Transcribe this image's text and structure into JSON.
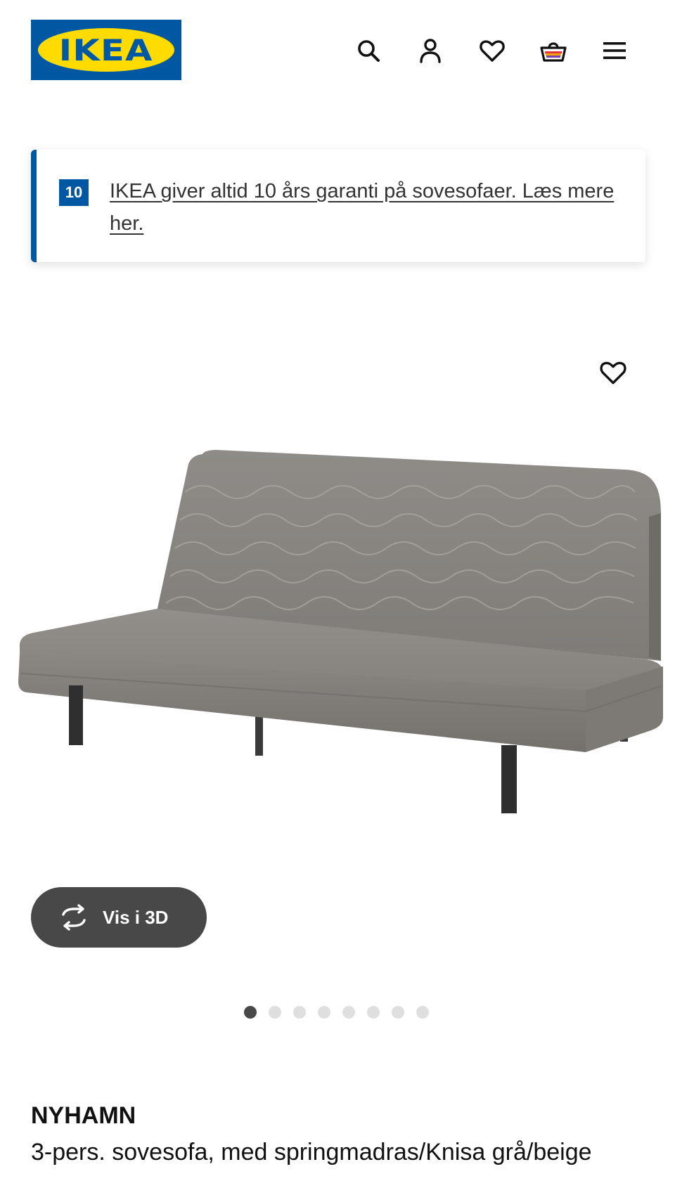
{
  "header": {
    "logo_text": "IKEA",
    "icons": [
      "search-icon",
      "user-icon",
      "heart-icon",
      "basket-icon",
      "menu-icon"
    ]
  },
  "banner": {
    "badge": "10",
    "text": "IKEA giver altid 10 års garanti på sovesofaer. Læs mere her."
  },
  "media": {
    "favourite_icon": "heart-icon",
    "view_3d_label": "Vis i 3D",
    "view_3d_icon": "rotate-icon",
    "carousel": {
      "total": 8,
      "active": 1
    }
  },
  "product": {
    "name": "NYHAMN",
    "description": "3-pers. sovesofa, med springmadras/Knisa grå/beige"
  },
  "colors": {
    "brand_blue": "#0058a3",
    "brand_yellow": "#ffdb00",
    "button_dark": "#484848"
  }
}
